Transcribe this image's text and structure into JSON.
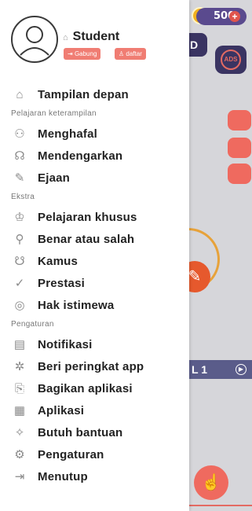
{
  "background": {
    "coins": "500",
    "coin_plus": "+",
    "ads_label": "ADS",
    "level_label": "L 1",
    "partial_top": "0",
    "partial_close": "D"
  },
  "profile": {
    "name": "Student",
    "join_label": "Gabung",
    "register_label": "daftar"
  },
  "menu": {
    "home": "Tampilan depan",
    "section_skills": "Pelajaran keterampilan",
    "memorize": "Menghafal",
    "listen": "Mendengarkan",
    "spelling": "Ejaan",
    "section_extra": "Ekstra",
    "special": "Pelajaran khusus",
    "truefalse": "Benar atau salah",
    "dictionary": "Kamus",
    "achievement": "Prestasi",
    "privilege": "Hak istimewa",
    "section_settings": "Pengaturan",
    "notifications": "Notifikasi",
    "rate": "Beri peringkat app",
    "share": "Bagikan aplikasi",
    "apps": "Aplikasi",
    "help": "Butuh bantuan",
    "settings": "Pengaturan",
    "close": "Menutup"
  }
}
